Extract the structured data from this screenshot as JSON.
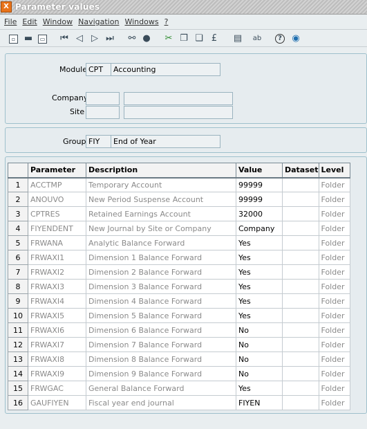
{
  "window": {
    "title": "Parameter values",
    "icon": "app-icon"
  },
  "menu": [
    "File",
    "Edit",
    "Window",
    "Navigation",
    "Windows",
    "?"
  ],
  "toolbar": [
    {
      "name": "new-icon",
      "glyph": "▫"
    },
    {
      "name": "print-icon",
      "glyph": "▬"
    },
    {
      "name": "preview-icon",
      "glyph": "▭"
    },
    {
      "name": "first-record-icon",
      "glyph": "⏮"
    },
    {
      "name": "previous-record-icon",
      "glyph": "◁"
    },
    {
      "name": "next-record-icon",
      "glyph": "▷"
    },
    {
      "name": "last-record-icon",
      "glyph": "⏭"
    },
    {
      "name": "attachment-icon",
      "glyph": "⚯"
    },
    {
      "name": "comment-icon",
      "glyph": "●"
    },
    {
      "name": "cut-icon",
      "glyph": "✂"
    },
    {
      "name": "copy-icon",
      "glyph": "❐"
    },
    {
      "name": "paste-icon",
      "glyph": "❏"
    },
    {
      "name": "calculator-icon",
      "glyph": "£"
    },
    {
      "name": "form-icon",
      "glyph": "▤"
    },
    {
      "name": "text-icon",
      "glyph": "ab"
    },
    {
      "name": "help-icon",
      "glyph": "?"
    },
    {
      "name": "web-icon",
      "glyph": "◉"
    }
  ],
  "module": {
    "label": "Module",
    "code": "CPT",
    "description": "Accounting"
  },
  "company": {
    "label": "Company",
    "code": "",
    "description": ""
  },
  "site": {
    "label": "Site",
    "code": "",
    "description": ""
  },
  "group": {
    "label": "Group",
    "code": "FIY",
    "description": "End of Year"
  },
  "table": {
    "columns": [
      "Parameter",
      "Description",
      "Value",
      "Dataset",
      "Level"
    ],
    "rows": [
      {
        "num": "1",
        "parameter": "ACCTMP",
        "description": "Temporary Account",
        "value": "99999",
        "dataset": "",
        "level": "Folder"
      },
      {
        "num": "2",
        "parameter": "ANOUVO",
        "description": "New Period Suspense Account",
        "value": "99999",
        "dataset": "",
        "level": "Folder"
      },
      {
        "num": "3",
        "parameter": "CPTRES",
        "description": "Retained Earnings Account",
        "value": "32000",
        "dataset": "",
        "level": "Folder"
      },
      {
        "num": "4",
        "parameter": "FIYENDENT",
        "description": "New Journal by Site or Company",
        "value": "Company",
        "dataset": "",
        "level": "Folder"
      },
      {
        "num": "5",
        "parameter": "FRWANA",
        "description": "Analytic Balance Forward",
        "value": "Yes",
        "dataset": "",
        "level": "Folder"
      },
      {
        "num": "6",
        "parameter": "FRWAXI1",
        "description": "Dimension 1 Balance Forward",
        "value": "Yes",
        "dataset": "",
        "level": "Folder"
      },
      {
        "num": "7",
        "parameter": "FRWAXI2",
        "description": "Dimension 2 Balance Forward",
        "value": "Yes",
        "dataset": "",
        "level": "Folder"
      },
      {
        "num": "8",
        "parameter": "FRWAXI3",
        "description": "Dimension 3 Balance Forward",
        "value": "Yes",
        "dataset": "",
        "level": "Folder"
      },
      {
        "num": "9",
        "parameter": "FRWAXI4",
        "description": "Dimension 4 Balance Forward",
        "value": "Yes",
        "dataset": "",
        "level": "Folder"
      },
      {
        "num": "10",
        "parameter": "FRWAXI5",
        "description": "Dimension 5 Balance Forward",
        "value": "Yes",
        "dataset": "",
        "level": "Folder"
      },
      {
        "num": "11",
        "parameter": "FRWAXI6",
        "description": "Dimension 6 Balance Forward",
        "value": "No",
        "dataset": "",
        "level": "Folder"
      },
      {
        "num": "12",
        "parameter": "FRWAXI7",
        "description": "Dimension 7 Balance Forward",
        "value": "No",
        "dataset": "",
        "level": "Folder"
      },
      {
        "num": "13",
        "parameter": "FRWAXI8",
        "description": "Dimension 8 Balance Forward",
        "value": "No",
        "dataset": "",
        "level": "Folder"
      },
      {
        "num": "14",
        "parameter": "FRWAXI9",
        "description": "Dimension 9 Balance Forward",
        "value": "No",
        "dataset": "",
        "level": "Folder"
      },
      {
        "num": "15",
        "parameter": "FRWGAC",
        "description": "General Balance Forward",
        "value": "Yes",
        "dataset": "",
        "level": "Folder"
      },
      {
        "num": "16",
        "parameter": "GAUFIYEN",
        "description": "Fiscal year end journal",
        "value": "FIYEN",
        "dataset": "",
        "level": "Folder"
      }
    ]
  }
}
